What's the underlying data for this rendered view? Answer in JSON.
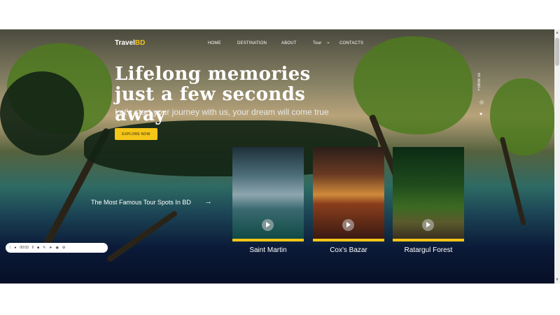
{
  "brand": {
    "name_part1": "Travel",
    "name_part2": "BD"
  },
  "nav": {
    "items": [
      "HOME",
      "DESTINATION",
      "ABOUT",
      "Tour",
      "CONTACTS"
    ],
    "dropdown_icon": "chevron-down-icon"
  },
  "hero": {
    "title": "Lifelong memories just a few seconds away",
    "subtitle": "Let's start your journey with us, your dream will come true",
    "cta_label": "EXPLORE NOW"
  },
  "social": {
    "follow_label": "Follow us",
    "icons": [
      "instagram-icon",
      "twitter-icon"
    ]
  },
  "spots": {
    "heading": "The Most Famous Tour Spots In BD",
    "cards": [
      {
        "label": "Saint Martin"
      },
      {
        "label": "Cox's Bazar"
      },
      {
        "label": "Ratargul Forest"
      }
    ]
  },
  "player": {
    "time": "00:03"
  },
  "colors": {
    "accent": "#f5c518",
    "night_sea": "#0b1a38"
  }
}
